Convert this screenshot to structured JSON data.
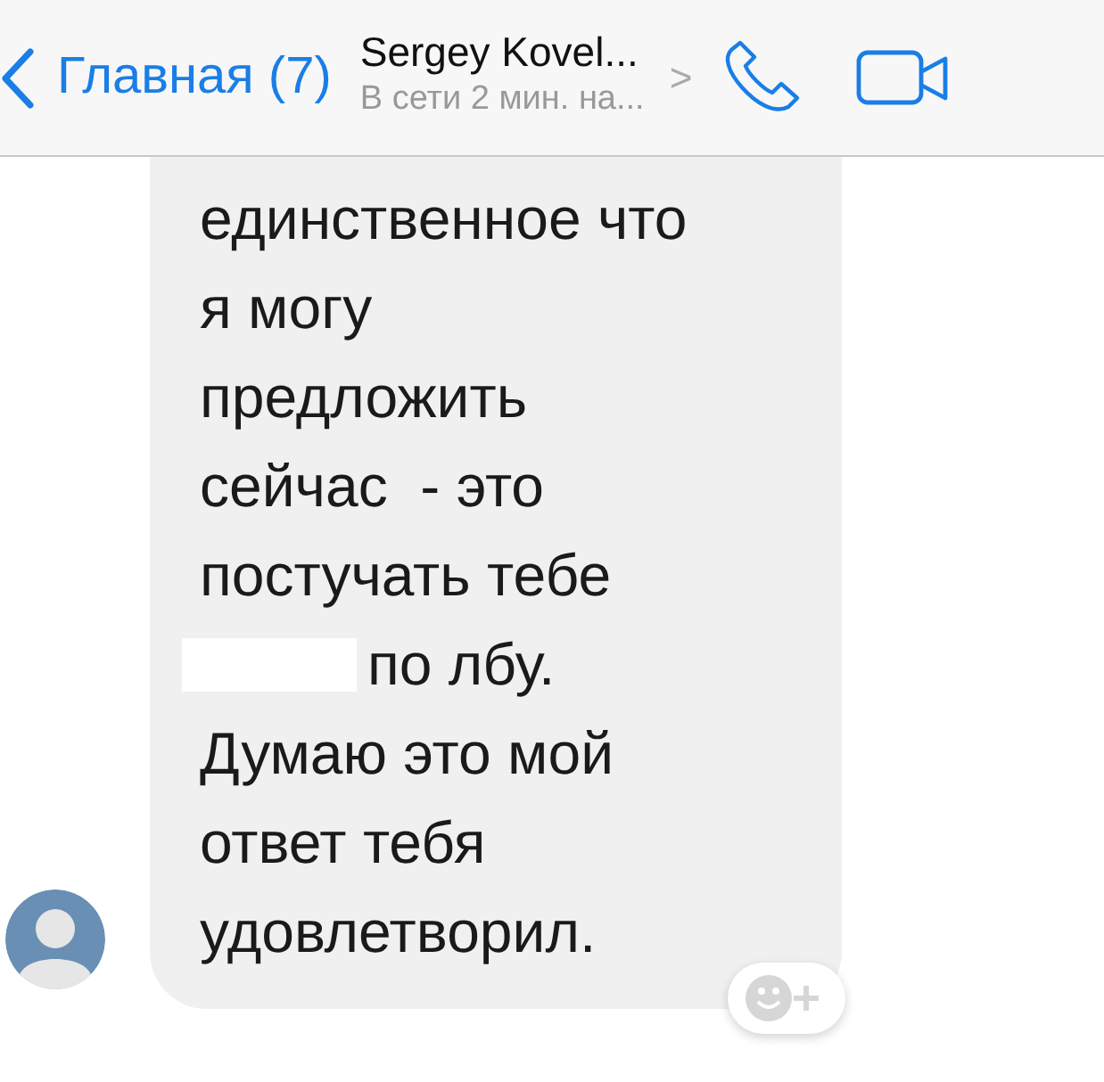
{
  "header": {
    "back_label": "Главная (7)",
    "contact_name": "Sergey Kovel...",
    "chevron": ">",
    "status": "В сети 2 мин. на..."
  },
  "message": {
    "lines": [
      {
        "text": "единственное что",
        "redacted_before": false
      },
      {
        "text": "я могу",
        "redacted_before": false
      },
      {
        "text": "предложить",
        "redacted_before": false
      },
      {
        "text": "сейчас  - это",
        "redacted_before": false
      },
      {
        "text": "постучать тебе",
        "redacted_before": false
      },
      {
        "text": "по лбу.",
        "redacted_before": true
      },
      {
        "text": "Думаю это мой",
        "redacted_before": false
      },
      {
        "text": "ответ тебя",
        "redacted_before": false
      },
      {
        "text": "удовлетворил.",
        "redacted_before": false
      }
    ]
  }
}
